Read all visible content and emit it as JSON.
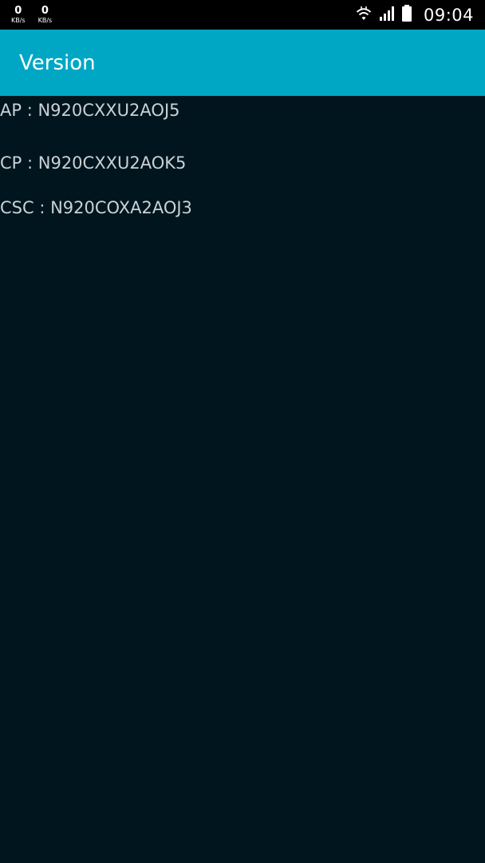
{
  "status_bar": {
    "speed": [
      {
        "value": "0",
        "unit": "KB/s"
      },
      {
        "value": "0",
        "unit": "KB/s"
      }
    ],
    "icons": [
      "wifi-icon",
      "signal-icon",
      "battery-icon"
    ],
    "time": "09:04"
  },
  "app_bar": {
    "title": "Version"
  },
  "versions": [
    {
      "text": "AP : N920CXXU2AOJ5"
    },
    {
      "text": "CP : N920CXXU2AOK5"
    },
    {
      "text": "CSC : N920COXA2AOJ3"
    }
  ],
  "colors": {
    "status_bar_bg": "#000000",
    "app_bar_bg": "#00a7c5",
    "background": "#01151e",
    "text": "#c9d2d6"
  }
}
